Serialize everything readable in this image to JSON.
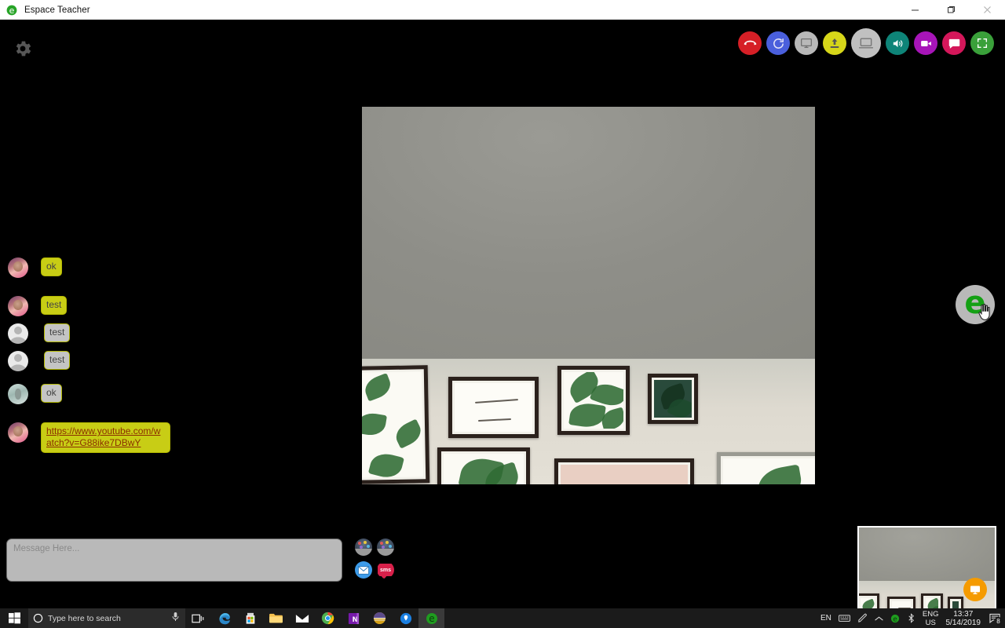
{
  "window": {
    "title": "Espace Teacher",
    "app_icon": "espace-logo-icon",
    "minimize_label": "–",
    "maximize_label": "❐",
    "close_label": "✕"
  },
  "header": {
    "settings_icon": "gear-icon",
    "toolbar": [
      {
        "name": "hang-up-button",
        "icon": "phone-hangup-icon",
        "color": "#d61f26"
      },
      {
        "name": "refresh-button",
        "icon": "refresh-icon",
        "color": "#4a5fdc"
      },
      {
        "name": "share-screen-button",
        "icon": "monitor-icon",
        "color": "#b8b8b8"
      },
      {
        "name": "upload-button",
        "icon": "upload-arrow-icon",
        "color": "#d6d619"
      },
      {
        "name": "present-button",
        "icon": "laptop-icon",
        "color": "#c0c0c0"
      },
      {
        "name": "speaker-button",
        "icon": "speaker-icon",
        "color": "#0e8478"
      },
      {
        "name": "camera-button",
        "icon": "video-camera-icon",
        "color": "#a715b8"
      },
      {
        "name": "chat-button",
        "icon": "chat-bubble-icon",
        "color": "#d4175a"
      },
      {
        "name": "fullscreen-button",
        "icon": "fullscreen-icon",
        "color": "#3aa03a"
      }
    ]
  },
  "video": {
    "main_label": "main-video-feed",
    "thumbnail_label": "self-video-thumbnail",
    "thumbnail_button_icon": "monitor-icon"
  },
  "side": {
    "logo_letter": "e",
    "logo_name": "espace-logo-button",
    "cursor_icon": "hand-pointer-icon"
  },
  "chat": {
    "messages": [
      {
        "avatar": "p1",
        "text": "ok",
        "style": "yellow",
        "is_link": false
      },
      {
        "avatar": "p1",
        "text": "test",
        "style": "yellow",
        "is_link": false
      },
      {
        "avatar": "blank",
        "text": "test",
        "style": "grey",
        "is_link": false
      },
      {
        "avatar": "blank",
        "text": "test",
        "style": "grey",
        "is_link": false
      },
      {
        "avatar": "p2",
        "text": "ok",
        "style": "grey",
        "is_link": false
      },
      {
        "avatar": "p1",
        "text": "https://www.youtube.com/watch?v=G88ike7DBwY",
        "style": "yellow",
        "is_link": true
      }
    ]
  },
  "composer": {
    "placeholder": "Message Here...",
    "value": "",
    "actions": [
      {
        "name": "attach-image-button",
        "icon": "gallery-icon",
        "label": ""
      },
      {
        "name": "attach-image-2-button",
        "icon": "gallery-icon",
        "label": ""
      },
      {
        "name": "send-email-button",
        "icon": "envelope-icon",
        "label": ""
      },
      {
        "name": "send-sms-button",
        "icon": "sms-bubble-icon",
        "label": "sms"
      }
    ]
  },
  "taskbar": {
    "start_icon": "windows-start-icon",
    "search_placeholder": "Type here to search",
    "search_icon": "cortana-circle-icon",
    "mic_icon": "microphone-icon",
    "apps": [
      {
        "name": "task-view-button",
        "icon": "task-view-icon"
      },
      {
        "name": "edge-button",
        "icon": "edge-icon"
      },
      {
        "name": "microsoft-store-button",
        "icon": "store-icon"
      },
      {
        "name": "file-explorer-button",
        "icon": "folder-icon"
      },
      {
        "name": "mail-button",
        "icon": "mail-icon"
      },
      {
        "name": "chrome-button",
        "icon": "chrome-icon"
      },
      {
        "name": "onenote-button",
        "icon": "onenote-icon"
      },
      {
        "name": "purple-app-button",
        "icon": "circle-app-icon"
      },
      {
        "name": "maps-button",
        "icon": "maps-pin-icon"
      },
      {
        "name": "espace-button",
        "icon": "espace-logo-icon"
      }
    ],
    "tray": {
      "lang_short": "EN",
      "keyboard_icon": "keyboard-icon",
      "pen_icon": "pen-icon",
      "chevron_icon": "chevron-up-icon",
      "espace_tray_icon": "espace-logo-icon",
      "bluetooth_icon": "bluetooth-icon",
      "lang_line1": "ENG",
      "lang_line2": "US",
      "time": "13:37",
      "date": "5/14/2019",
      "notifications_icon": "action-center-icon",
      "notifications_count": "8"
    }
  }
}
